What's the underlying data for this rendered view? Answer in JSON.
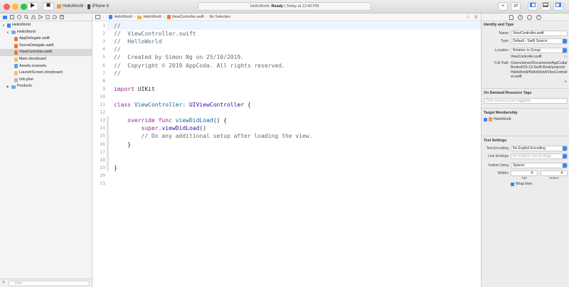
{
  "toolbar": {
    "scheme_target": "HelloWorld",
    "scheme_device": "iPhone 8",
    "status_project": "HelloWorld:",
    "status_state": "Ready",
    "status_time": "| Today at 12:40 PM"
  },
  "jumpbar": {
    "crumbs": [
      "HelloWorld",
      "HelloWorld",
      "ViewController.swift",
      "No Selection"
    ]
  },
  "navigator": {
    "items": [
      {
        "label": "HelloWorld",
        "level": 0,
        "type": "project"
      },
      {
        "label": "HelloWorld",
        "level": 1,
        "type": "folder"
      },
      {
        "label": "AppDelegate.swift",
        "level": 2,
        "type": "swift"
      },
      {
        "label": "SceneDelegate.swift",
        "level": 2,
        "type": "swift"
      },
      {
        "label": "ViewController.swift",
        "level": 2,
        "type": "swift",
        "selected": true
      },
      {
        "label": "Main.storyboard",
        "level": 2,
        "type": "storyboard"
      },
      {
        "label": "Assets.xcassets",
        "level": 2,
        "type": "assets"
      },
      {
        "label": "LaunchScreen.storyboard",
        "level": 2,
        "type": "storyboard"
      },
      {
        "label": "Info.plist",
        "level": 2,
        "type": "plist"
      },
      {
        "label": "Products",
        "level": 1,
        "type": "folder"
      }
    ],
    "filter_placeholder": "Filter"
  },
  "editor": {
    "line_numbers": [
      "1",
      "2",
      "3",
      "4",
      "5",
      "6",
      "7",
      "8",
      "9",
      "10",
      "11",
      "12",
      "13",
      "14",
      "15",
      "16",
      "17",
      "18",
      "19",
      "20",
      "21"
    ],
    "lines": [
      "//",
      "//  ViewController.swift",
      "//  HelloWorld",
      "//",
      "//  Created by Simon Ng on 25/10/2019.",
      "//  Copyright © 2019 AppCoda. All rights reserved.",
      "//",
      "",
      "import UIKit",
      "",
      "class ViewController: UIViewController {",
      "",
      "    override func viewDidLoad() {",
      "        super.viewDidLoad()",
      "        // Do any additional setup after loading the view.",
      "    }",
      "",
      "",
      "}",
      "",
      ""
    ],
    "tokens": {
      "import_kw": "import",
      "import_name": " UIKit",
      "class_kw": "class",
      "class_name": " ViewController: ",
      "class_super": "UIViewController",
      "class_brace": " {",
      "indent4": "    ",
      "indent8": "        ",
      "override_kw": "override",
      "func_kw": " func",
      "func_name": " viewDidLoad",
      "func_tail": "() {",
      "super_kw": "super",
      "super_call": ".viewDidLoad",
      "super_tail": "()",
      "comment_setup": "// Do any additional setup after loading the view.",
      "close_brace4": "    }",
      "close_brace": "}"
    }
  },
  "inspector": {
    "identity_title": "Identity and Type",
    "name_label": "Name",
    "name_value": "ViewController.swift",
    "type_label": "Type",
    "type_value": "Default - Swift Source",
    "location_label": "Location",
    "location_value": "Relative to Group",
    "location_file": "ViewController.swift",
    "fullpath_label": "Full Path",
    "fullpath_value": "/Users/simon/Documents/AppCoda/Books/iOS-13-Swift-Book/projects/HelloWorld/HelloWorld/ViewController.swift",
    "odr_title": "On Demand Resource Tags",
    "odr_placeholder": "Only resources are taggable",
    "target_title": "Target Membership",
    "target_name": "HelloWorld",
    "text_title": "Text Settings",
    "encoding_label": "Text Encoding",
    "encoding_value": "No Explicit Encoding",
    "line_endings_label": "Line Endings",
    "line_endings_value": "No Explicit Line Endings",
    "indent_label": "Indent Using",
    "indent_value": "Spaces",
    "widths_label": "Widths",
    "tab_value": "4",
    "indent_width_value": "4",
    "tab_caption": "Tab",
    "indent_caption": "Indent",
    "wrap_label": "Wrap lines"
  }
}
